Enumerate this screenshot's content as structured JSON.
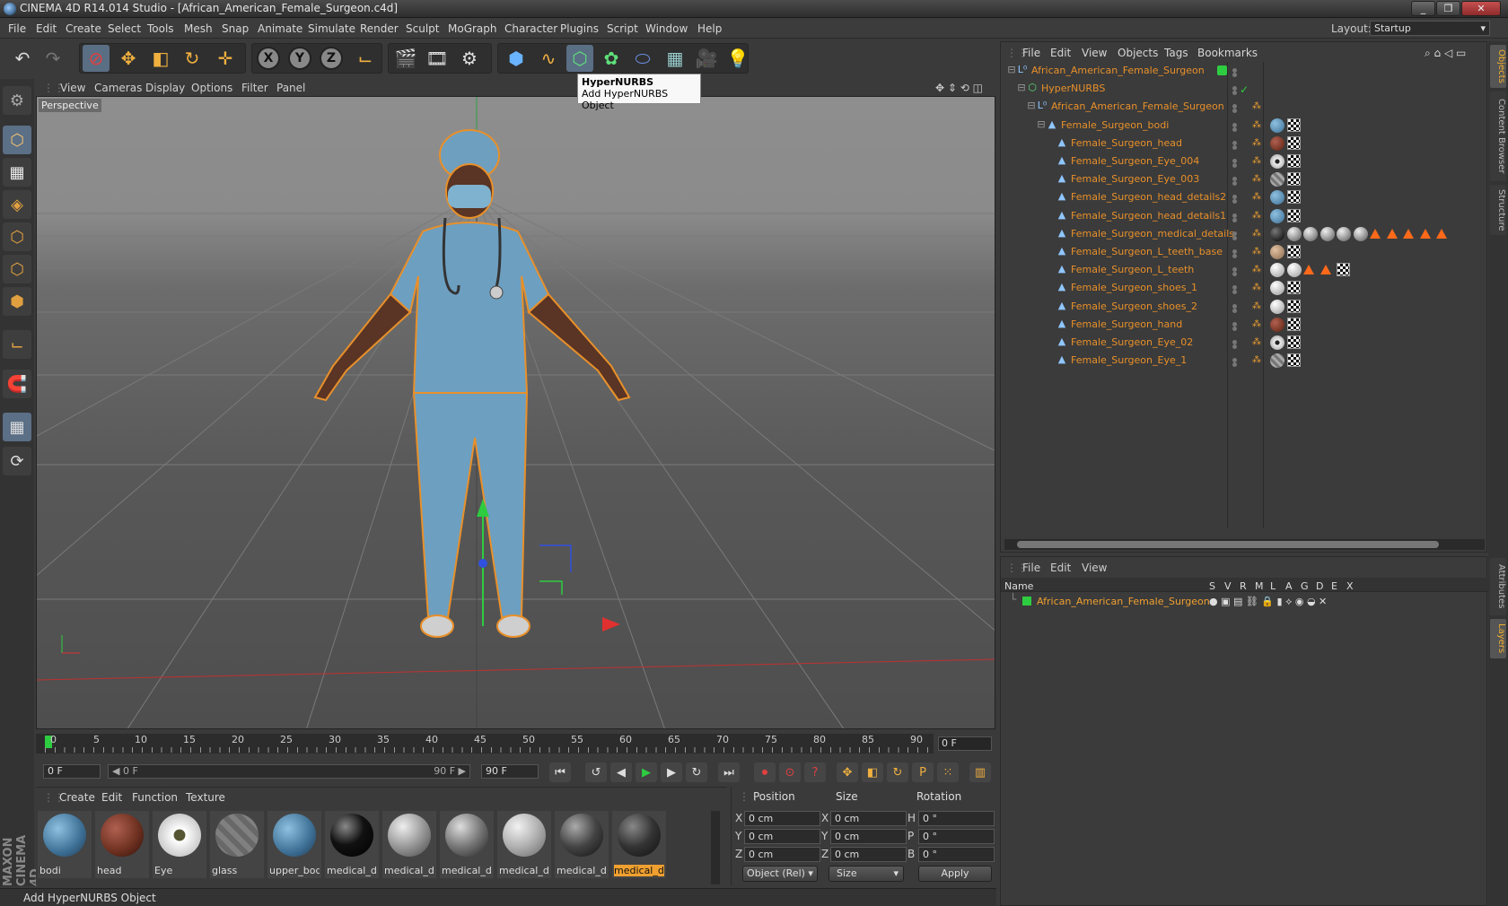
{
  "window": {
    "title": "CINEMA 4D R14.014 Studio - [African_American_Female_Surgeon.c4d]",
    "controls": [
      "_",
      "❐",
      "✕"
    ]
  },
  "menubar": {
    "items": [
      "File",
      "Edit",
      "Create",
      "Select",
      "Tools",
      "Mesh",
      "Snap",
      "Animate",
      "Simulate",
      "Render",
      "Sculpt",
      "MoGraph",
      "Character",
      "Plugins",
      "Script",
      "Window",
      "Help"
    ],
    "layout_label": "Layout:",
    "layout_value": "Startup"
  },
  "tooltip": {
    "title": "HyperNURBS",
    "desc": "Add HyperNURBS Object"
  },
  "viewport": {
    "menu": [
      "View",
      "Cameras",
      "Display",
      "Options",
      "Filter",
      "Panel"
    ],
    "label": "Perspective"
  },
  "timeline": {
    "ticks": [
      "0",
      "5",
      "10",
      "15",
      "20",
      "25",
      "30",
      "35",
      "40",
      "45",
      "50",
      "55",
      "60",
      "65",
      "70",
      "75",
      "80",
      "85",
      "90"
    ],
    "current_frame": "0 F"
  },
  "transport": {
    "start": "0 F",
    "range_start": "◀ 0 F",
    "range_end": "90 F ▶",
    "end": "90 F"
  },
  "materials": {
    "menu": [
      "Create",
      "Edit",
      "Function",
      "Texture"
    ],
    "items": [
      {
        "name": "bodi",
        "color": "#5a8fb5"
      },
      {
        "name": "head",
        "color": "#6a2e1e"
      },
      {
        "name": "Eye",
        "color": "#e8e8e8"
      },
      {
        "name": "glass",
        "color": "#777777"
      },
      {
        "name": "upper_bod",
        "color": "#5a8fb5"
      },
      {
        "name": "medical_de",
        "color": "#111111"
      },
      {
        "name": "medical_de",
        "color": "#a0a0a0"
      },
      {
        "name": "medical_de",
        "color": "#8a8a8a"
      },
      {
        "name": "medical_de",
        "color": "#c0c0c0"
      },
      {
        "name": "medical_de",
        "color": "#555555"
      },
      {
        "name": "medical_de",
        "color": "#333333"
      }
    ]
  },
  "coordinates": {
    "headers": [
      "Position",
      "Size",
      "Rotation"
    ],
    "rows": [
      {
        "a": "X",
        "pos": "0 cm",
        "b": "X",
        "size": "0 cm",
        "c": "H",
        "rot": "0 °"
      },
      {
        "a": "Y",
        "pos": "0 cm",
        "b": "Y",
        "size": "0 cm",
        "c": "P",
        "rot": "0 °"
      },
      {
        "a": "Z",
        "pos": "0 cm",
        "b": "Z",
        "size": "0 cm",
        "c": "B",
        "rot": "0 °"
      }
    ],
    "mode": "Object (Rel) ▾",
    "size_mode": "Size",
    "apply": "Apply"
  },
  "status": "Add HyperNURBS Object",
  "object_manager": {
    "menu": [
      "File",
      "Edit",
      "View",
      "Objects",
      "Tags",
      "Bookmarks"
    ],
    "rows": [
      {
        "name": "African_American_Female_Surgeon",
        "indent": 0,
        "icon": "null-icon"
      },
      {
        "name": "HyperNURBS",
        "indent": 1,
        "icon": "hypernurbs-icon"
      },
      {
        "name": "African_American_Female_Surgeon",
        "indent": 2,
        "icon": "null-icon"
      },
      {
        "name": "Female_Surgeon_bodi",
        "indent": 3,
        "icon": "polygon-icon"
      },
      {
        "name": "Female_Surgeon_head",
        "indent": 4,
        "icon": "polygon-icon"
      },
      {
        "name": "Female_Surgeon_Eye_004",
        "indent": 4,
        "icon": "polygon-icon"
      },
      {
        "name": "Female_Surgeon_Eye_003",
        "indent": 4,
        "icon": "polygon-icon"
      },
      {
        "name": "Female_Surgeon_head_details2",
        "indent": 4,
        "icon": "polygon-icon"
      },
      {
        "name": "Female_Surgeon_head_details1",
        "indent": 4,
        "icon": "polygon-icon"
      },
      {
        "name": "Female_Surgeon_medical_details",
        "indent": 4,
        "icon": "polygon-icon"
      },
      {
        "name": "Female_Surgeon_L_teeth_base",
        "indent": 4,
        "icon": "polygon-icon"
      },
      {
        "name": "Female_Surgeon_L_teeth",
        "indent": 4,
        "icon": "polygon-icon"
      },
      {
        "name": "Female_Surgeon_shoes_1",
        "indent": 4,
        "icon": "polygon-icon"
      },
      {
        "name": "Female_Surgeon_shoes_2",
        "indent": 4,
        "icon": "polygon-icon"
      },
      {
        "name": "Female_Surgeon_hand",
        "indent": 4,
        "icon": "polygon-icon"
      },
      {
        "name": "Female_Surgeon_Eye_02",
        "indent": 4,
        "icon": "polygon-icon"
      },
      {
        "name": "Female_Surgeon_Eye_1",
        "indent": 4,
        "icon": "polygon-icon"
      }
    ]
  },
  "layer_manager": {
    "menu": [
      "File",
      "Edit",
      "View"
    ],
    "columns": [
      "Name",
      "S",
      "V",
      "R",
      "M",
      "L",
      "A",
      "G",
      "D",
      "E",
      "X"
    ],
    "layer_name": "African_American_Female_Surgeon"
  },
  "right_tabs": [
    "Objects",
    "Content Browser",
    "Structure",
    "Attributes",
    "Layers"
  ]
}
